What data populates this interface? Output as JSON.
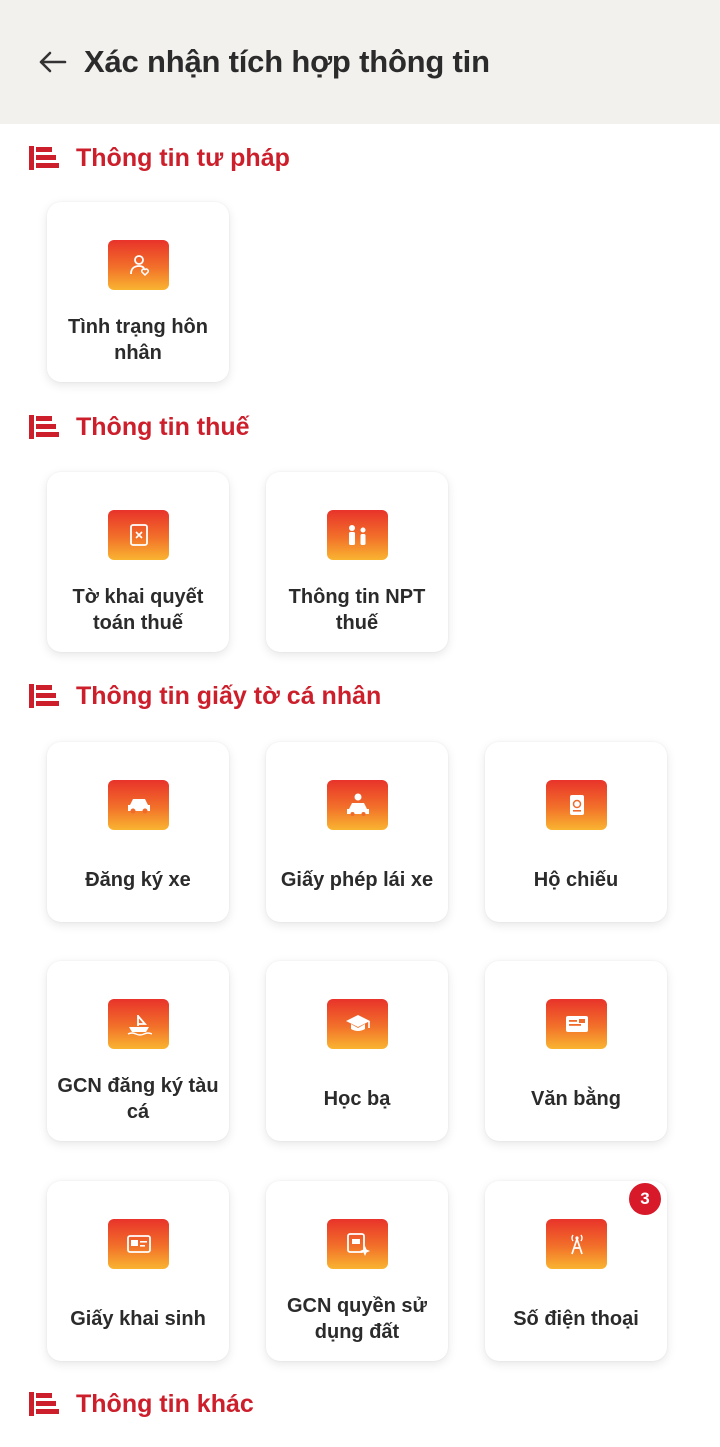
{
  "header": {
    "title": "Xác nhận tích hợp thông tin"
  },
  "sections": [
    {
      "title": "Thông tin tư pháp",
      "items": [
        {
          "label": "Tình trạng hôn nhân",
          "icon": "marriage-icon"
        }
      ]
    },
    {
      "title": "Thông tin thuế",
      "items": [
        {
          "label": "Tờ khai quyết toán thuế",
          "icon": "tax-form-icon"
        },
        {
          "label": "Thông tin NPT thuế",
          "icon": "dependents-icon"
        }
      ]
    },
    {
      "title": "Thông tin giấy tờ cá nhân",
      "items": [
        {
          "label": "Đăng ký xe",
          "icon": "car-icon"
        },
        {
          "label": "Giấy phép lái xe",
          "icon": "driver-license-icon"
        },
        {
          "label": "Hộ chiếu",
          "icon": "passport-icon"
        },
        {
          "label": "GCN đăng ký tàu cá",
          "icon": "fishing-boat-icon"
        },
        {
          "label": "Học bạ",
          "icon": "graduation-cap-icon"
        },
        {
          "label": "Văn bằng",
          "icon": "diploma-icon"
        },
        {
          "label": "Giấy khai sinh",
          "icon": "birth-certificate-icon"
        },
        {
          "label": "GCN quyền sử dụng đất",
          "icon": "land-certificate-icon"
        },
        {
          "label": "Số điện thoại",
          "icon": "phone-tower-icon",
          "badge": "3"
        }
      ]
    },
    {
      "title": "Thông tin khác",
      "items": []
    }
  ],
  "colors": {
    "accent": "#cc1f2b",
    "header_bg": "#f3f1ee",
    "badge": "#d7192a"
  }
}
